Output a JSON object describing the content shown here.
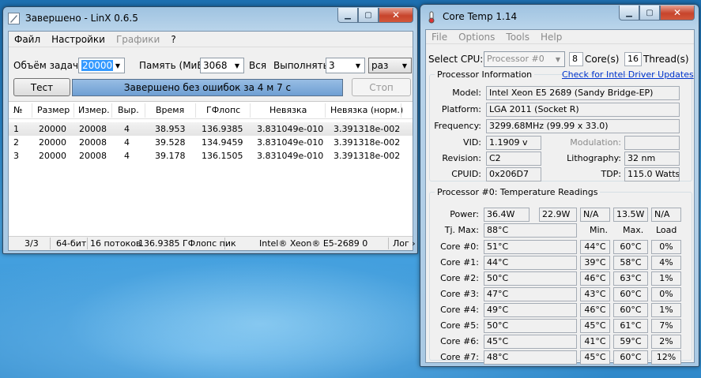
{
  "linx": {
    "title": "Завершено - LinX 0.6.5",
    "menu": [
      {
        "label": "Файл",
        "disabled": false
      },
      {
        "label": "Настройки",
        "disabled": false
      },
      {
        "label": "Графики",
        "disabled": true
      },
      {
        "label": "?",
        "disabled": false
      }
    ],
    "problem_size_label": "Объём задачи:",
    "problem_size_value": "20000",
    "memory_label": "Память (МиБ):",
    "memory_value": "3068",
    "all_label": "Вся",
    "run_label": "Выполнять:",
    "run_value": "3",
    "run_unit": "раз",
    "test_button": "Тест",
    "status_message": "Завершено без ошибок за 4 м 7 с",
    "stop_button": "Стоп",
    "columns": [
      "№",
      "Размер",
      "Измер.",
      "Выр.",
      "Время",
      "ГФлопс",
      "Невязка",
      "Невязка (норм.)"
    ],
    "rows": [
      [
        "1",
        "20000",
        "20008",
        "4",
        "38.953",
        "136.9385",
        "3.831049e-010",
        "3.391318e-002"
      ],
      [
        "2",
        "20000",
        "20008",
        "4",
        "39.528",
        "134.9459",
        "3.831049e-010",
        "3.391318e-002"
      ],
      [
        "3",
        "20000",
        "20008",
        "4",
        "39.178",
        "136.1505",
        "3.831049e-010",
        "3.391318e-002"
      ]
    ],
    "status": {
      "progress": "3/3",
      "bits": "64-бит",
      "threads": "16 потоков",
      "peak": "136.9385 ГФлопс пик",
      "cpu": "Intel® Xeon® E5-2689 0",
      "log": "Лог"
    }
  },
  "coretemp": {
    "title": "Core Temp 1.14",
    "menu": [
      "File",
      "Options",
      "Tools",
      "Help"
    ],
    "select_cpu_label": "Select CPU:",
    "select_cpu_value": "Processor #0",
    "cores_value": "8",
    "cores_label": "Core(s)",
    "threads_value": "16",
    "threads_label": "Thread(s)",
    "proc_info_title": "Processor Information",
    "driver_link": "Check for Intel Driver Updates",
    "model_label": "Model:",
    "model_value": "Intel Xeon E5 2689 (Sandy Bridge-EP)",
    "platform_label": "Platform:",
    "platform_value": "LGA 2011 (Socket R)",
    "frequency_label": "Frequency:",
    "frequency_value": "3299.68MHz (99.99 x 33.0)",
    "vid_label": "VID:",
    "vid_value": "1.1909 v",
    "modulation_label": "Modulation:",
    "modulation_value": "",
    "revision_label": "Revision:",
    "revision_value": "C2",
    "lithography_label": "Lithography:",
    "lithography_value": "32 nm",
    "cpuid_label": "CPUID:",
    "cpuid_value": "0x206D7",
    "tdp_label": "TDP:",
    "tdp_value": "115.0 Watts",
    "temp_title": "Processor #0: Temperature Readings",
    "power_label": "Power:",
    "power_values": [
      "36.4W",
      "22.9W",
      "N/A",
      "13.5W",
      "N/A"
    ],
    "tjmax_label": "Tj. Max:",
    "tjmax_value": "88°C",
    "min_label": "Min.",
    "max_label": "Max.",
    "load_label": "Load",
    "cores": [
      {
        "label": "Core #0:",
        "temp": "51°C",
        "min": "44°C",
        "max": "60°C",
        "load": "0%"
      },
      {
        "label": "Core #1:",
        "temp": "44°C",
        "min": "39°C",
        "max": "58°C",
        "load": "4%"
      },
      {
        "label": "Core #2:",
        "temp": "50°C",
        "min": "46°C",
        "max": "63°C",
        "load": "1%"
      },
      {
        "label": "Core #3:",
        "temp": "47°C",
        "min": "43°C",
        "max": "60°C",
        "load": "0%"
      },
      {
        "label": "Core #4:",
        "temp": "49°C",
        "min": "46°C",
        "max": "60°C",
        "load": "1%"
      },
      {
        "label": "Core #5:",
        "temp": "50°C",
        "min": "45°C",
        "max": "61°C",
        "load": "7%"
      },
      {
        "label": "Core #6:",
        "temp": "45°C",
        "min": "41°C",
        "max": "59°C",
        "load": "2%"
      },
      {
        "label": "Core #7:",
        "temp": "48°C",
        "min": "45°C",
        "max": "60°C",
        "load": "12%"
      }
    ]
  }
}
